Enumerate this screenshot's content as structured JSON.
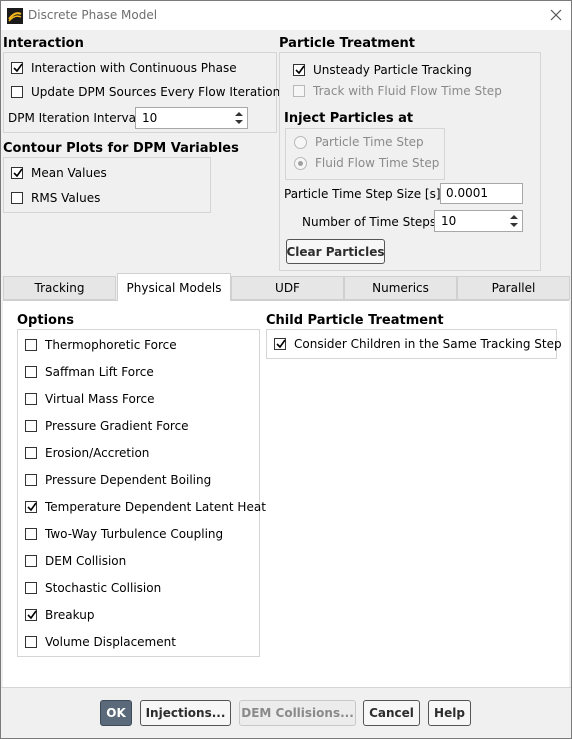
{
  "window": {
    "title": "Discrete Phase Model"
  },
  "interaction": {
    "title": "Interaction",
    "items": [
      {
        "label": "Interaction with Continuous Phase",
        "checked": true
      },
      {
        "label": "Update DPM Sources Every Flow Iteration",
        "checked": false
      }
    ],
    "iteration_interval": {
      "label": "DPM Iteration Interval",
      "value": "10"
    }
  },
  "contour": {
    "title": "Contour Plots for DPM Variables",
    "items": [
      {
        "label": "Mean Values",
        "checked": true
      },
      {
        "label": "RMS Values",
        "checked": false
      }
    ]
  },
  "particle_treatment": {
    "title": "Particle Treatment",
    "items": [
      {
        "label": "Unsteady Particle Tracking",
        "checked": true
      },
      {
        "label": "Track with Fluid Flow Time Step",
        "checked": false,
        "disabled": true
      }
    ],
    "inject_title": "Inject Particles at",
    "inject_options": [
      {
        "label": "Particle Time Step",
        "selected": false
      },
      {
        "label": "Fluid Flow Time Step",
        "selected": true
      }
    ],
    "time_step_size": {
      "label": "Particle Time Step Size [s]",
      "value": "0.0001"
    },
    "num_time_steps": {
      "label": "Number of Time Steps",
      "value": "10"
    },
    "clear_button": "Clear Particles"
  },
  "tabs": [
    {
      "label": "Tracking",
      "active": false
    },
    {
      "label": "Physical Models",
      "active": true
    },
    {
      "label": "UDF",
      "active": false
    },
    {
      "label": "Numerics",
      "active": false
    },
    {
      "label": "Parallel",
      "active": false
    }
  ],
  "options": {
    "title": "Options",
    "items": [
      {
        "label": "Thermophoretic Force",
        "checked": false
      },
      {
        "label": "Saffman Lift Force",
        "checked": false
      },
      {
        "label": "Virtual Mass Force",
        "checked": false
      },
      {
        "label": "Pressure Gradient Force",
        "checked": false
      },
      {
        "label": "Erosion/Accretion",
        "checked": false
      },
      {
        "label": "Pressure Dependent Boiling",
        "checked": false
      },
      {
        "label": "Temperature Dependent Latent Heat",
        "checked": true
      },
      {
        "label": "Two-Way Turbulence Coupling",
        "checked": false
      },
      {
        "label": "DEM Collision",
        "checked": false
      },
      {
        "label": "Stochastic Collision",
        "checked": false
      },
      {
        "label": "Breakup",
        "checked": true
      },
      {
        "label": "Volume Displacement",
        "checked": false
      }
    ]
  },
  "child_particle": {
    "title": "Child Particle Treatment",
    "items": [
      {
        "label": "Consider Children in the Same Tracking Step",
        "checked": true
      }
    ]
  },
  "buttons": {
    "ok": "OK",
    "injections": "Injections...",
    "dem_collisions": "DEM Collisions...",
    "cancel": "Cancel",
    "help": "Help"
  }
}
